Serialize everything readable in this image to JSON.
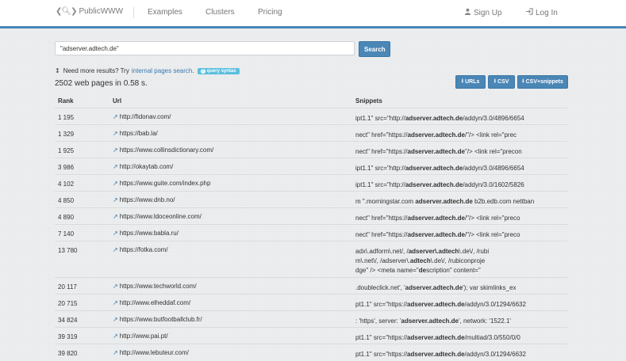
{
  "navbar": {
    "brand": "PublicWWW",
    "links": [
      "Examples",
      "Clusters",
      "Pricing"
    ],
    "signup": "Sign Up",
    "login": "Log In"
  },
  "search": {
    "value": "\"adserver.adtech.de\"",
    "button": "Search"
  },
  "more_results": {
    "prefix": "Need more results? Try",
    "link": "internal pages search",
    "suffix": ".",
    "badge": "query syntax"
  },
  "results_count": "2502 web pages in 0.58 s.",
  "export_buttons": [
    "URLs",
    "CSV",
    "CSV+snippets"
  ],
  "table": {
    "headers": [
      "Rank",
      "Url",
      "Snippets"
    ],
    "rows": [
      {
        "rank": "1 195",
        "url": "http://fidonav.com/",
        "snippet": [
          [
            "ipt1.1\" src=\"http://",
            "adserver.adtech.de",
            "/addyn/3.0/4896/6654"
          ]
        ]
      },
      {
        "rank": "1 329",
        "url": "https://bab.la/",
        "snippet": [
          [
            "nect\" href=\"https://",
            "adserver.adtech.de",
            "/\"/> <link rel=\"prec"
          ]
        ]
      },
      {
        "rank": "1 925",
        "url": "https://www.collinsdictionary.com/",
        "snippet": [
          [
            "nect\" href=\"https://",
            "adserver.adtech.de",
            "\"/> <link rel=\"precon"
          ]
        ]
      },
      {
        "rank": "3 986",
        "url": "http://okaytab.com/",
        "snippet": [
          [
            "ipt1.1\" src=\"http://",
            "adserver.adtech.de",
            "/addyn/3.0/4896/6654"
          ]
        ]
      },
      {
        "rank": "4 102",
        "url": "https://www.guite.com/index.php",
        "snippet": [
          [
            "ipt1.1\" src=\"http://",
            "adserver.adtech.de",
            "/addyn/3.0/1602/5826"
          ]
        ]
      },
      {
        "rank": "4 850",
        "url": "https://www.dnb.no/",
        "snippet": [
          [
            "m \".morningstar.com ",
            "adserver.adtech.de",
            " b2b.edb.com nettban"
          ]
        ]
      },
      {
        "rank": "4 890",
        "url": "https://www.ldoceonline.com/",
        "snippet": [
          [
            "nect\" href=\"https://",
            "adserver.adtech.de",
            "/\"/> <link rel=\"preco"
          ]
        ]
      },
      {
        "rank": "7 140",
        "url": "https://www.babla.ru/",
        "snippet": [
          [
            "nect\" href=\"https://",
            "adserver.adtech.de",
            "/\"/> <link rel=\"preco"
          ]
        ]
      },
      {
        "rank": "13 780",
        "url": "https://fotka.com/",
        "snippet": [
          [
            "adx\\.adform\\.net/, /",
            "adserver\\.adtech",
            "\\.de\\/, /rubi"
          ],
          [
            "m\\.net\\/, /adserver\\.",
            "adtech",
            "\\.de\\/, /rubiconproje"
          ],
          [
            "dge\" /> <meta name=\"",
            "de",
            "scription\" content=\""
          ]
        ]
      },
      {
        "rank": "20 117",
        "url": "https://www.techworld.com/",
        "snippet": [
          [
            ".doubleclick.net', '",
            "adserver.adtech.de",
            "'); var skimlinks_ex"
          ]
        ]
      },
      {
        "rank": "20 715",
        "url": "http://www.elheddaf.com/",
        "snippet": [
          [
            "pt1.1\" src=\"https://",
            "adserver.adtech.de",
            "/addyn/3.0/1294/6632"
          ]
        ]
      },
      {
        "rank": "34 824",
        "url": "https://www.butfootballclub.fr/",
        "snippet": [
          [
            ": 'https', server: '",
            "adserver.adtech.de",
            "', network: '1522.1'"
          ]
        ]
      },
      {
        "rank": "39 319",
        "url": "http://www.pai.pt/",
        "snippet": [
          [
            "pt1.1\" src=\"https://",
            "adserver.adtech.de",
            "/multiad/3.0/550/0/0"
          ]
        ]
      },
      {
        "rank": "39 820",
        "url": "http://www.lebuteur.com/",
        "snippet": [
          [
            "pt1.1\" src=\"https://",
            "adserver.adtech.de",
            "/addyn/3.0/1294/6632"
          ]
        ]
      }
    ]
  },
  "icons": {
    "nav_arrows": "chevron-left-search-chevron-right",
    "signup": "user-icon",
    "login": "sign-in-icon",
    "info": "info-vertical-icon",
    "download": "download-icon",
    "external": "external-link-icon",
    "badge": "question-icon"
  },
  "colors": {
    "accent": "#4a86b6",
    "link": "#3a78b0",
    "badge": "#5bc0de",
    "background": "#eceeef"
  }
}
